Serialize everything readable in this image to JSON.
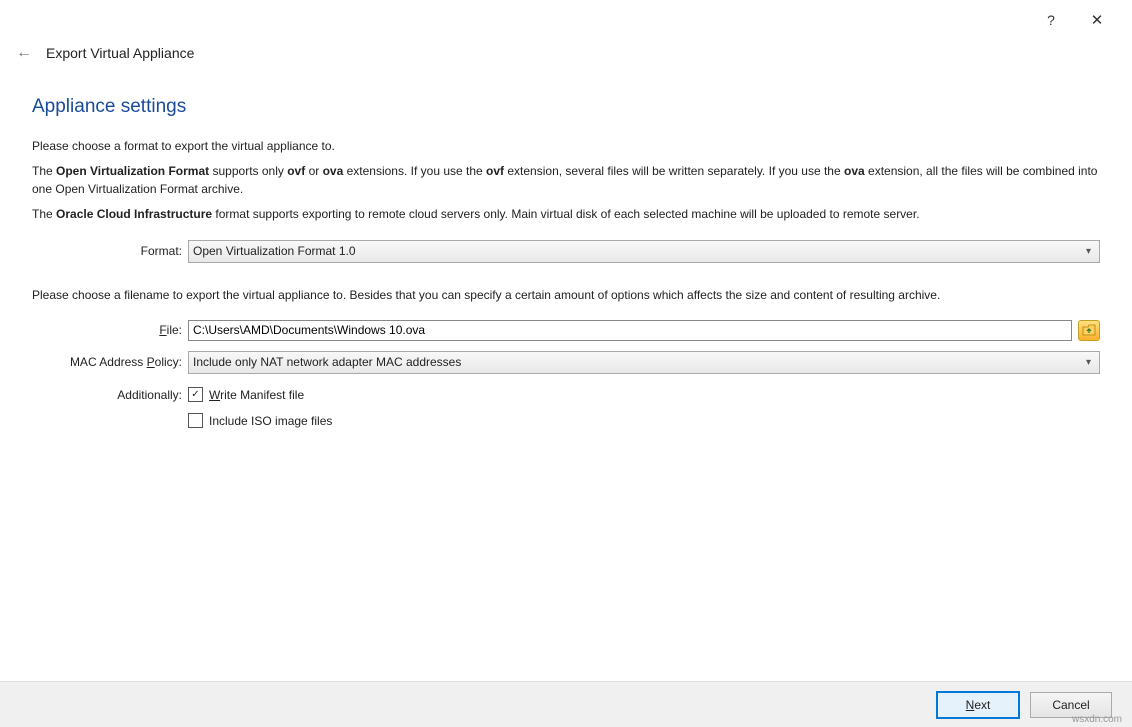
{
  "titlebar": {
    "help": "?",
    "close": "✕"
  },
  "header": {
    "back": "←",
    "title": "Export Virtual Appliance"
  },
  "section_heading": "Appliance settings",
  "intro": "Please choose a format to export the virtual appliance to.",
  "para2_prefix": "The ",
  "para2_b1": "Open Virtualization Format",
  "para2_mid1": " supports only ",
  "para2_b2": "ovf",
  "para2_mid2": " or ",
  "para2_b3": "ova",
  "para2_mid3": " extensions. If you use the ",
  "para2_b4": "ovf",
  "para2_mid4": " extension, several files will be written separately. If you use the ",
  "para2_b5": "ova",
  "para2_end": " extension, all the files will be combined into one Open Virtualization Format archive.",
  "para3_prefix": "The ",
  "para3_b1": "Oracle Cloud Infrastructure",
  "para3_end": " format supports exporting to remote cloud servers only. Main virtual disk of each selected machine will be uploaded to remote server.",
  "format_label": "Format:",
  "format_value": "Open Virtualization Format 1.0",
  "file_desc": "Please choose a filename to export the virtual appliance to. Besides that you can specify a certain amount of options which affects the size and content of resulting archive.",
  "file_label": "File:",
  "file_value": "C:\\Users\\AMD\\Documents\\Windows 10.ova",
  "mac_label": "MAC Address Policy:",
  "mac_value": "Include only NAT network adapter MAC addresses",
  "additionally_label": "Additionally:",
  "cb1_label": "Write Manifest file",
  "cb1_checked": true,
  "cb2_label": "Include ISO image files",
  "cb2_checked": false,
  "footer": {
    "next": "Next",
    "cancel": "Cancel"
  },
  "watermark": "wsxdn.com"
}
